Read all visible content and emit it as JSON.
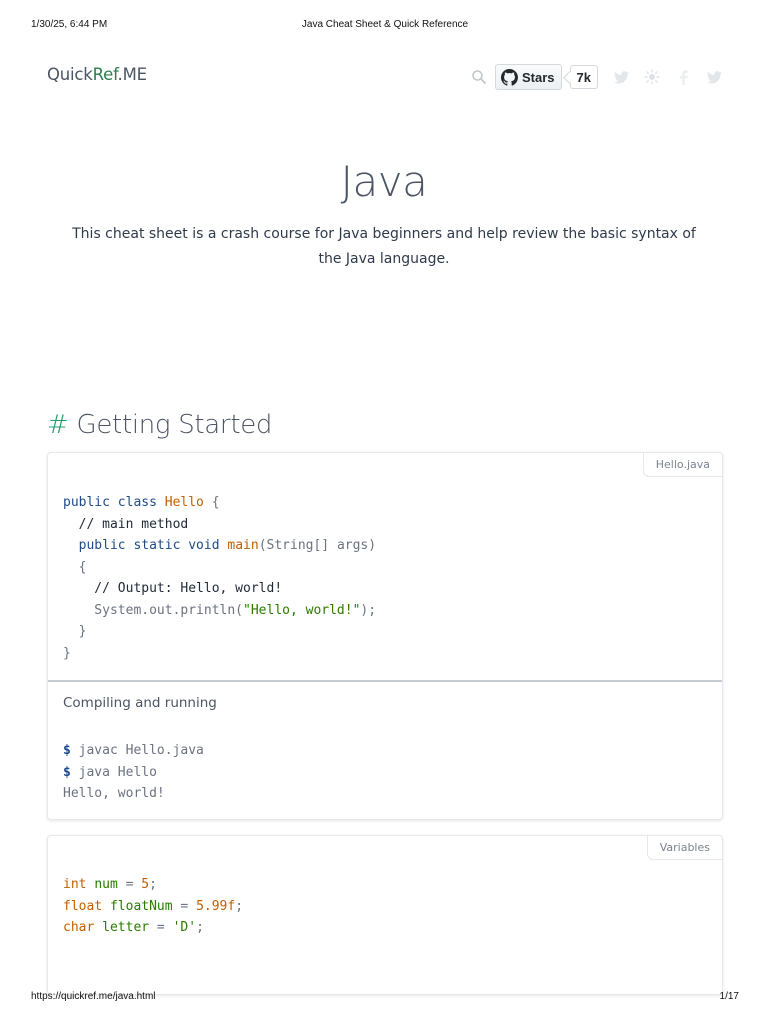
{
  "print_header": {
    "date": "1/30/25, 6:44 PM",
    "title": "Java Cheat Sheet & Quick Reference"
  },
  "print_footer": {
    "url": "https://quickref.me/java.html",
    "page": "1/17"
  },
  "logo": {
    "part1": "Quick",
    "part2": "Ref",
    "part3": ".ME"
  },
  "github": {
    "label": "Stars",
    "count": "7k"
  },
  "hero": {
    "title": "Java",
    "description": "This cheat sheet is a crash course for Java beginners and help review the basic syntax of the Java language."
  },
  "section": {
    "hash": "#",
    "title": "Getting Started"
  },
  "card_hello": {
    "tag": "Hello.java",
    "code": [
      [
        [
          "kw",
          "public class "
        ],
        [
          "cls",
          "Hello"
        ],
        [
          "pl",
          " {"
        ]
      ],
      [
        [
          "cm",
          "  // main method"
        ]
      ],
      [
        [
          "kw",
          "  public static void "
        ],
        [
          "fn",
          "main"
        ],
        [
          "pl",
          "(String[] args)"
        ]
      ],
      [
        [
          "pl",
          "  {"
        ]
      ],
      [
        [
          "cm",
          "    // Output: Hello, world!"
        ]
      ],
      [
        [
          "pl",
          "    System.out.println("
        ],
        [
          "str",
          "\"Hello, world!\""
        ],
        [
          "pl",
          ");"
        ]
      ],
      [
        [
          "pl",
          "  }"
        ]
      ],
      [
        [
          "pl",
          "}"
        ]
      ]
    ],
    "subtitle": "Compiling and running",
    "shell": [
      [
        [
          "pr",
          "$ "
        ],
        [
          "pl",
          "javac Hello.java"
        ]
      ],
      [
        [
          "pr",
          "$ "
        ],
        [
          "pl",
          "java Hello"
        ]
      ],
      [
        [
          "pl",
          "Hello, world!"
        ]
      ]
    ]
  },
  "card_variables": {
    "tag": "Variables",
    "code": [
      [
        [
          "ty",
          "int "
        ],
        [
          "vr",
          "num"
        ],
        [
          "pl",
          " = "
        ],
        [
          "nm",
          "5"
        ],
        [
          "pl",
          ";"
        ]
      ],
      [
        [
          "ty",
          "float "
        ],
        [
          "vr",
          "floatNum"
        ],
        [
          "pl",
          " = "
        ],
        [
          "nm",
          "5.99f"
        ],
        [
          "pl",
          ";"
        ]
      ],
      [
        [
          "ty",
          "char "
        ],
        [
          "vr",
          "letter"
        ],
        [
          "pl",
          " = "
        ],
        [
          "str",
          "'D'"
        ],
        [
          "pl",
          ";"
        ]
      ]
    ]
  }
}
